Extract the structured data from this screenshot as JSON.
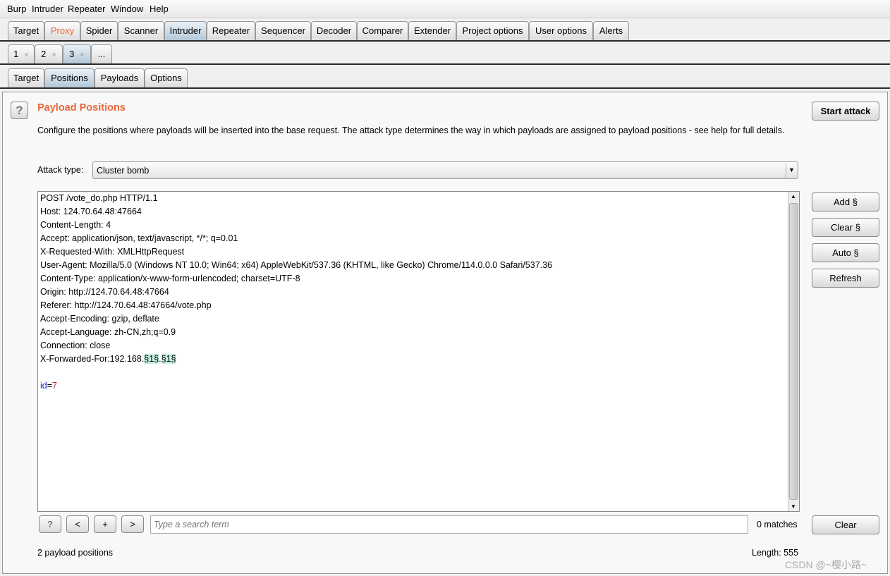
{
  "menu": [
    "Burp",
    "Intruder",
    "Repeater",
    "Window",
    "Help"
  ],
  "main_tabs": [
    "Target",
    "Proxy",
    "Spider",
    "Scanner",
    "Intruder",
    "Repeater",
    "Sequencer",
    "Decoder",
    "Comparer",
    "Extender",
    "Project options",
    "User options",
    "Alerts"
  ],
  "attack_tabs": [
    {
      "label": "1",
      "close": "×"
    },
    {
      "label": "2",
      "close": "×"
    },
    {
      "label": "3",
      "close": "×"
    },
    {
      "label": "..."
    }
  ],
  "sub_tabs": [
    "Target",
    "Positions",
    "Payloads",
    "Options"
  ],
  "section": {
    "title": "Payload Positions",
    "description": "Configure the positions where payloads will be inserted into the base request. The attack type determines the way in which payloads are assigned to payload positions - see help for full details.",
    "help": "?"
  },
  "start_attack": "Start attack",
  "attack_type": {
    "label": "Attack type:",
    "value": "Cluster bomb"
  },
  "request_lines": [
    "POST /vote_do.php HTTP/1.1",
    "Host: 124.70.64.48:47664",
    "Content-Length: 4",
    "Accept: application/json, text/javascript, */*; q=0.01",
    "X-Requested-With: XMLHttpRequest",
    "User-Agent: Mozilla/5.0 (Windows NT 10.0; Win64; x64) AppleWebKit/537.36 (KHTML, like Gecko) Chrome/114.0.0.0 Safari/537.36",
    "Content-Type: application/x-www-form-urlencoded; charset=UTF-8",
    "Origin: http://124.70.64.48:47664",
    "Referer: http://124.70.64.48:47664/vote.php",
    "Accept-Encoding: gzip, deflate",
    "Accept-Language: zh-CN,zh;q=0.9",
    "Connection: close"
  ],
  "xff": {
    "prefix": "X-Forwarded-For:192.168.",
    "p1": "§1§",
    "dot": ".",
    "p2": "§1§"
  },
  "body": {
    "key": "id",
    "eq": "=",
    "value": "7"
  },
  "side_buttons": [
    "Add §",
    "Clear §",
    "Auto §",
    "Refresh"
  ],
  "search": {
    "help": "?",
    "prev": "<",
    "add": "+",
    "next": ">",
    "placeholder": "Type a search term",
    "matches": "0 matches",
    "clear": "Clear"
  },
  "footer": {
    "positions": "2 payload positions",
    "length": "Length: 555"
  },
  "watermark": "CSDN @~樱小路~",
  "colors": {
    "accent": "#e8693b",
    "highlight": "#c6efe3",
    "selected_tab": "#b3c7d8"
  }
}
